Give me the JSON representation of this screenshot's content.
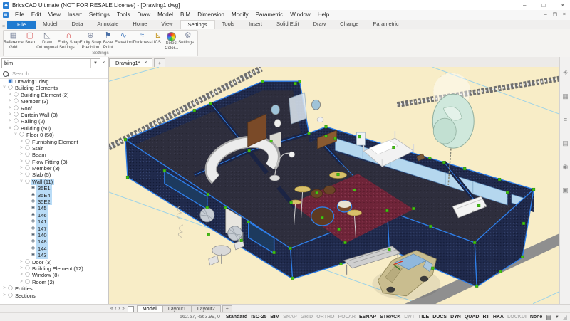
{
  "window": {
    "title": "BricsCAD Ultimate (NOT FOR RESALE License) - [Drawing1.dwg]",
    "controls": {
      "minimize": "–",
      "maximize": "□",
      "close": "×"
    },
    "mdi_controls": {
      "minimize": "–",
      "restore": "❐",
      "close": "×"
    }
  },
  "menu": {
    "items": [
      "File",
      "Edit",
      "View",
      "Insert",
      "Settings",
      "Tools",
      "Draw",
      "Model",
      "BIM",
      "Dimension",
      "Modify",
      "Parametric",
      "Window",
      "Help"
    ]
  },
  "ribbon": {
    "file_tab": "File",
    "tabs": [
      "Model",
      "Data",
      "Annotate",
      "Home",
      "View",
      "Settings",
      "Tools",
      "Insert",
      "Solid Edit",
      "Draw",
      "Change",
      "Parametric"
    ],
    "active_tab": "Settings",
    "group_label": "Settings",
    "buttons": [
      {
        "name": "reference-grid-button",
        "icon": "reference-grid-icon",
        "glyph": "▦",
        "color": "#8a93a8",
        "lines": [
          "Reference",
          "Grid"
        ]
      },
      {
        "name": "snap-button",
        "icon": "snap-icon",
        "glyph": "▢",
        "color": "#d23c3c",
        "lines": [
          "Snap",
          ""
        ]
      },
      {
        "name": "draw-orthogonal-button",
        "icon": "draw-orthogonal-icon",
        "glyph": "◺",
        "color": "#6e7687",
        "lines": [
          "Draw",
          "Orthogonal"
        ]
      },
      {
        "name": "entity-snap-settings-button",
        "icon": "magnet-icon",
        "glyph": "∩",
        "color": "#d23c3c",
        "lines": [
          "Entity Snap",
          "Settings..."
        ]
      },
      {
        "name": "entity-snap-precision-button",
        "icon": "crosshair-icon",
        "glyph": "⊕",
        "color": "#8a93a8",
        "lines": [
          "Entity Snap",
          "Precision"
        ]
      },
      {
        "name": "base-point-button",
        "icon": "flag-icon",
        "glyph": "⚑",
        "color": "#4a6fa5",
        "lines": [
          "Base",
          "Point"
        ]
      },
      {
        "name": "elevation-button",
        "icon": "wave-icon",
        "glyph": "∿",
        "color": "#4a7fc1",
        "lines": [
          "Elevation",
          ""
        ]
      },
      {
        "name": "thickness-button",
        "icon": "thickness-icon",
        "glyph": "≈",
        "color": "#4a7fc1",
        "lines": [
          "Thickness",
          ""
        ]
      },
      {
        "name": "ucs-button",
        "icon": "ucs-axis-icon",
        "glyph": "⊾",
        "color": "#c79a2a",
        "lines": [
          "UCS...",
          ""
        ]
      },
      {
        "name": "select-color-button",
        "icon": "color-wheel-icon",
        "glyph": "conic",
        "color": "",
        "lines": [
          "Select",
          "Color..."
        ]
      },
      {
        "name": "settings-button",
        "icon": "gear-icon",
        "glyph": "⚙",
        "color": "#8a93a8",
        "lines": [
          "Settings...",
          ""
        ]
      }
    ]
  },
  "panel": {
    "combo_value": "bim",
    "search_placeholder": "Search",
    "tree": [
      {
        "label": "Drawing1.dwg",
        "depth": 0,
        "exp": "none",
        "icon": "doc",
        "sel": false
      },
      {
        "label": "Building Elements",
        "depth": 0,
        "exp": "open",
        "icon": "cat",
        "sel": false
      },
      {
        "label": "Building Element (2)",
        "depth": 1,
        "exp": "closed",
        "icon": "cat",
        "sel": false
      },
      {
        "label": "Member (3)",
        "depth": 1,
        "exp": "closed",
        "icon": "cat",
        "sel": false
      },
      {
        "label": "Roof",
        "depth": 1,
        "exp": "closed",
        "icon": "cat",
        "sel": false
      },
      {
        "label": "Curtain Wall (3)",
        "depth": 1,
        "exp": "closed",
        "icon": "cat",
        "sel": false
      },
      {
        "label": "Railing (2)",
        "depth": 1,
        "exp": "closed",
        "icon": "cat",
        "sel": false
      },
      {
        "label": "Building (50)",
        "depth": 1,
        "exp": "open",
        "icon": "cat",
        "sel": false
      },
      {
        "label": "Floor 0 (50)",
        "depth": 2,
        "exp": "open",
        "icon": "cat",
        "sel": false
      },
      {
        "label": "Furnishing Element",
        "depth": 3,
        "exp": "closed",
        "icon": "cat",
        "sel": false
      },
      {
        "label": "Stair",
        "depth": 3,
        "exp": "closed",
        "icon": "cat",
        "sel": false
      },
      {
        "label": "Beam",
        "depth": 3,
        "exp": "closed",
        "icon": "cat",
        "sel": false
      },
      {
        "label": "Flow Fitting (3)",
        "depth": 3,
        "exp": "closed",
        "icon": "cat",
        "sel": false
      },
      {
        "label": "Member (3)",
        "depth": 3,
        "exp": "closed",
        "icon": "cat",
        "sel": false
      },
      {
        "label": "Slab (5)",
        "depth": 3,
        "exp": "closed",
        "icon": "cat",
        "sel": false
      },
      {
        "label": "Wall (11)",
        "depth": 3,
        "exp": "open",
        "icon": "cat",
        "sel": true
      },
      {
        "label": "35E1",
        "depth": 4,
        "exp": "none",
        "icon": "inst",
        "sel": true
      },
      {
        "label": "35E4",
        "depth": 4,
        "exp": "none",
        "icon": "inst",
        "sel": true
      },
      {
        "label": "35E2",
        "depth": 4,
        "exp": "none",
        "icon": "inst",
        "sel": true
      },
      {
        "label": "145",
        "depth": 4,
        "exp": "none",
        "icon": "inst",
        "sel": true
      },
      {
        "label": "146",
        "depth": 4,
        "exp": "none",
        "icon": "inst",
        "sel": true
      },
      {
        "label": "141",
        "depth": 4,
        "exp": "none",
        "icon": "inst",
        "sel": true
      },
      {
        "label": "147",
        "depth": 4,
        "exp": "none",
        "icon": "inst",
        "sel": true
      },
      {
        "label": "140",
        "depth": 4,
        "exp": "none",
        "icon": "inst",
        "sel": true
      },
      {
        "label": "148",
        "depth": 4,
        "exp": "none",
        "icon": "inst",
        "sel": true
      },
      {
        "label": "144",
        "depth": 4,
        "exp": "none",
        "icon": "inst",
        "sel": true
      },
      {
        "label": "143",
        "depth": 4,
        "exp": "none",
        "icon": "inst",
        "sel": true
      },
      {
        "label": "Door (3)",
        "depth": 3,
        "exp": "closed",
        "icon": "cat",
        "sel": false
      },
      {
        "label": "Building Element (12)",
        "depth": 3,
        "exp": "closed",
        "icon": "cat",
        "sel": false
      },
      {
        "label": "Window (8)",
        "depth": 3,
        "exp": "closed",
        "icon": "cat",
        "sel": false
      },
      {
        "label": "Room (2)",
        "depth": 3,
        "exp": "closed",
        "icon": "cat",
        "sel": false
      },
      {
        "label": "Entities",
        "depth": 0,
        "exp": "closed",
        "icon": "cat",
        "sel": false
      },
      {
        "label": "Sections",
        "depth": 0,
        "exp": "closed",
        "icon": "cat",
        "sel": false
      }
    ]
  },
  "drawing_tabs": {
    "active": "Drawing1*",
    "close": "×",
    "add": "+"
  },
  "right_toolbar": [
    {
      "name": "light-icon",
      "glyph": "☀"
    },
    {
      "name": "materials-icon",
      "glyph": "▦"
    },
    {
      "name": "properties-sliders-icon",
      "glyph": "≡"
    },
    {
      "name": "layers-icon",
      "glyph": "▤"
    },
    {
      "name": "navigation-sphere-icon",
      "glyph": "◉"
    },
    {
      "name": "render-icon",
      "glyph": "▣"
    }
  ],
  "layout_bar": {
    "nav": [
      "«",
      "‹",
      "›",
      "»"
    ],
    "tabs": [
      {
        "label": "Model",
        "active": true
      },
      {
        "label": "Layout1",
        "active": false
      },
      {
        "label": "Layout2",
        "active": false
      }
    ],
    "add": "+"
  },
  "statusbar": {
    "coordinates": "562.57, -563.99, 0",
    "toggles": [
      {
        "label": "Standard",
        "on": true
      },
      {
        "label": "ISO-25",
        "on": true
      },
      {
        "label": "BIM",
        "on": true
      },
      {
        "label": "SNAP",
        "on": false
      },
      {
        "label": "GRID",
        "on": false
      },
      {
        "label": "ORTHO",
        "on": false
      },
      {
        "label": "POLAR",
        "on": false
      },
      {
        "label": "ESNAP",
        "on": true
      },
      {
        "label": "STRACK",
        "on": true
      },
      {
        "label": "LWT",
        "on": false
      },
      {
        "label": "TILE",
        "on": true
      },
      {
        "label": "DUCS",
        "on": true
      },
      {
        "label": "DYN",
        "on": true
      },
      {
        "label": "QUAD",
        "on": true
      },
      {
        "label": "RT",
        "on": true
      },
      {
        "label": "HKA",
        "on": true
      },
      {
        "label": "LOCKUI",
        "on": false
      },
      {
        "label": "None",
        "on": true
      }
    ]
  },
  "colors": {
    "selection_blue": "#2e7ee8",
    "grip_green": "#44c412",
    "ground_beige": "#f8edc7",
    "wall_navy": "#202a4c",
    "accent_blue": "#1f7ad0"
  }
}
